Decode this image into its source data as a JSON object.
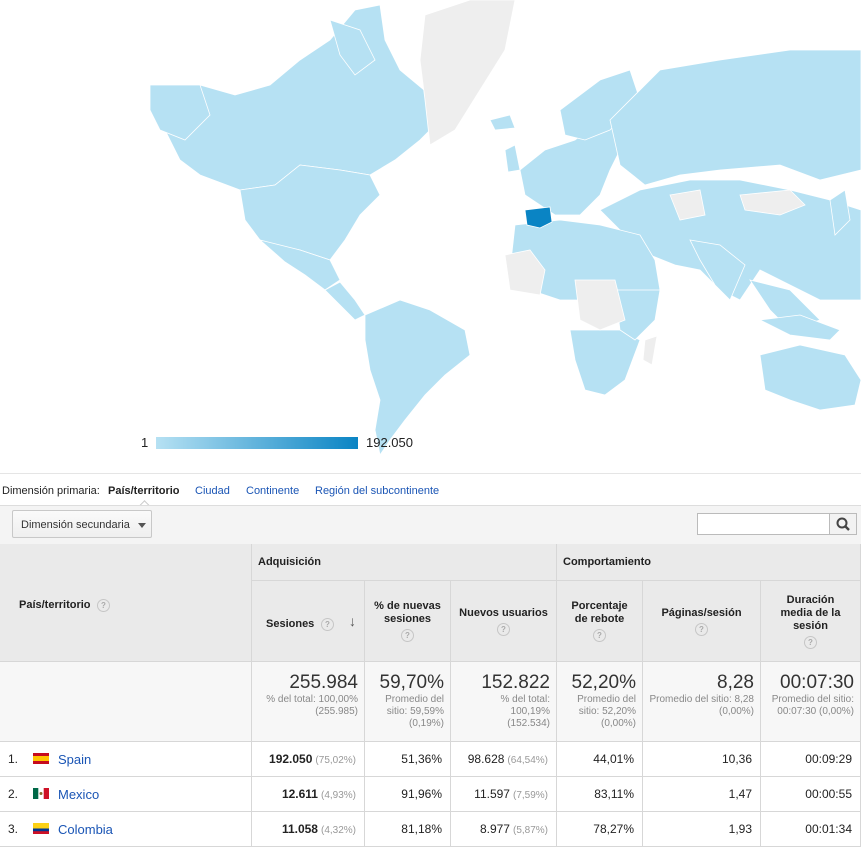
{
  "legend": {
    "min": "1",
    "max": "192.050",
    "color_min": "#b6e1f3",
    "color_max": "#0a84c4"
  },
  "dimension_bar": {
    "label": "Dimensión primaria:",
    "active": "País/territorio",
    "links": [
      "Ciudad",
      "Continente",
      "Región del subcontinente"
    ]
  },
  "toolbar": {
    "secondary_dimension": "Dimensión secundaria",
    "search_placeholder": ""
  },
  "table": {
    "first_col_header": "País/territorio",
    "groups": {
      "acquisition": "Adquisición",
      "behavior": "Comportamiento"
    },
    "columns": [
      "Sesiones",
      "% de nuevas sesiones",
      "Nuevos usuarios",
      "Porcentaje de rebote",
      "Páginas/sesión",
      "Duración media de la sesión"
    ],
    "totals": [
      {
        "big": "255.984",
        "sub": "% del total: 100,00% (255.985)"
      },
      {
        "big": "59,70%",
        "sub": "Promedio del sitio: 59,59% (0,19%)"
      },
      {
        "big": "152.822",
        "sub": "% del total: 100,19% (152.534)"
      },
      {
        "big": "52,20%",
        "sub": "Promedio del sitio: 52,20% (0,00%)"
      },
      {
        "big": "8,28",
        "sub": "Promedio del sitio: 8,28 (0,00%)"
      },
      {
        "big": "00:07:30",
        "sub": "Promedio del sitio: 00:07:30 (0,00%)"
      }
    ],
    "rows": [
      {
        "index": "1.",
        "country": "Spain",
        "flag": "spain-flag-icon",
        "sessions": "192.050",
        "sessions_pct": "(75,02%)",
        "new_sessions": "51,36%",
        "new_users": "98.628",
        "new_users_pct": "(64,54%)",
        "bounce": "44,01%",
        "pages": "10,36",
        "duration": "00:09:29"
      },
      {
        "index": "2.",
        "country": "Mexico",
        "flag": "mexico-flag-icon",
        "sessions": "12.611",
        "sessions_pct": "(4,93%)",
        "new_sessions": "91,96%",
        "new_users": "11.597",
        "new_users_pct": "(7,59%)",
        "bounce": "83,11%",
        "pages": "1,47",
        "duration": "00:00:55"
      },
      {
        "index": "3.",
        "country": "Colombia",
        "flag": "colombia-flag-icon",
        "sessions": "11.058",
        "sessions_pct": "(4,32%)",
        "new_sessions": "81,18%",
        "new_users": "8.977",
        "new_users_pct": "(5,87%)",
        "bounce": "78,27%",
        "pages": "1,93",
        "duration": "00:01:34"
      }
    ]
  }
}
